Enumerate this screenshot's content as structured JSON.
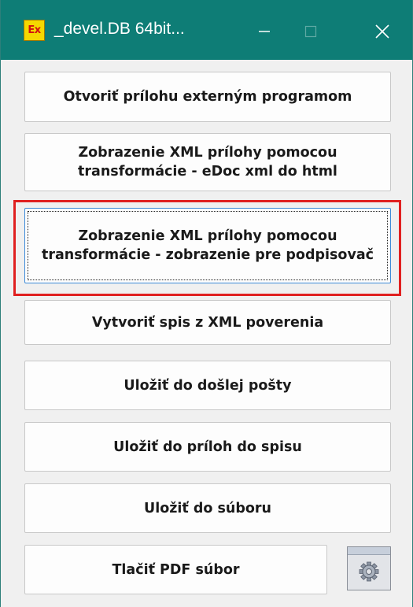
{
  "window": {
    "title": "_devel.DB 64bit...",
    "icon_text": "Ex",
    "accent_color": "#0e7d76"
  },
  "titlebar_controls": {
    "minimize_icon": "minimize-icon",
    "maximize_icon": "maximize-icon",
    "close_icon": "close-icon"
  },
  "buttons": {
    "open_external": "Otvoriť prílohu externým programom",
    "show_edoc_html": "Zobrazenie XML prílohy pomocou transformácie - eDoc xml do html",
    "show_signer_view": "Zobrazenie XML prílohy pomocou transformácie - zobrazenie pre podpisovač",
    "create_file_from_xml": "Vytvoriť spis z XML poverenia",
    "save_to_inbox": "Uložiť do došlej pošty",
    "save_to_attachments": "Uložiť do príloh do spisu",
    "save_to_file": "Uložiť do súboru",
    "print_pdf": "Tlačiť PDF súbor"
  },
  "settings_icon": "gear-icon",
  "highlight_color": "#e02020"
}
